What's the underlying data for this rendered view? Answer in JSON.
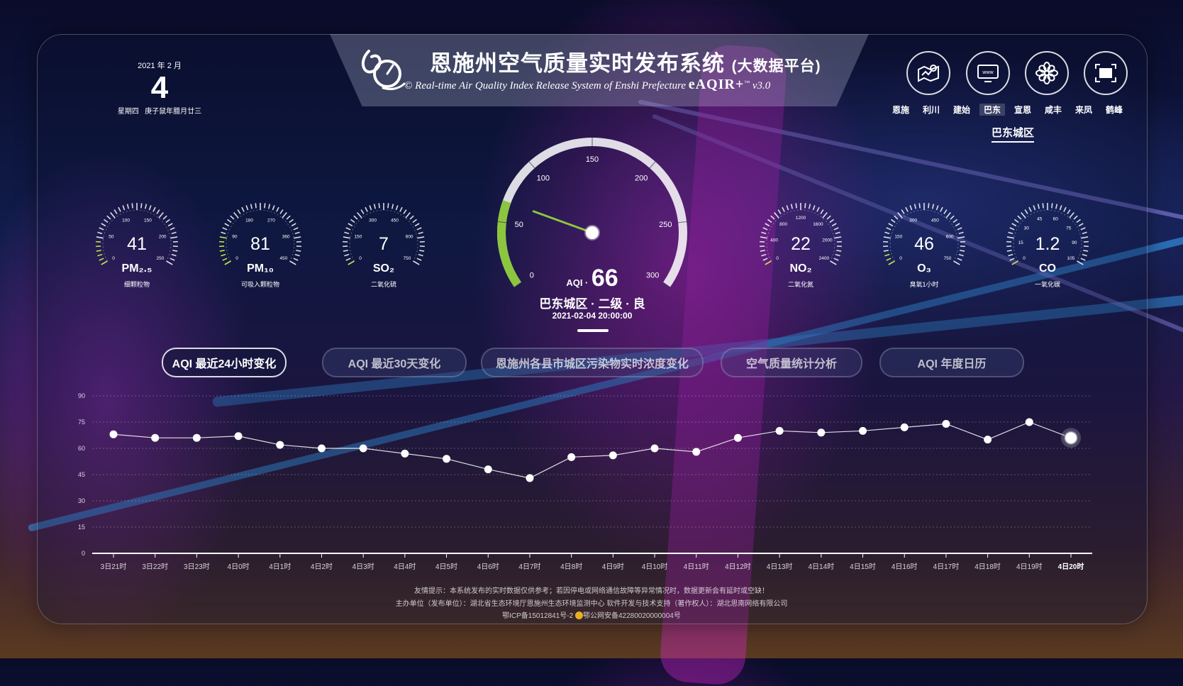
{
  "header": {
    "title": "恩施州空气质量实时发布系统",
    "title_sub": "(大数据平台)",
    "subtitle": "Real-time Air Quality Index Release System of Enshi Prefecture",
    "copyright": "©",
    "brand": "eAQIR+",
    "tm": "™",
    "version": "v3.0"
  },
  "date": {
    "year_month": "2021 年 2 月",
    "day": "4",
    "weekday": "星期四",
    "lunar": "庚子鼠年腊月廿三"
  },
  "icons": [
    {
      "name": "map-icon"
    },
    {
      "name": "web-icon"
    },
    {
      "name": "flower-icon"
    },
    {
      "name": "fullscreen-icon"
    }
  ],
  "cities": [
    "恩施",
    "利川",
    "建始",
    "巴东",
    "宣恩",
    "咸丰",
    "来凤",
    "鹤峰"
  ],
  "active_city": "巴东",
  "district": "巴东城区",
  "pollutants": [
    {
      "value": "41",
      "name": "PM₂.₅",
      "desc": "细颗粒物",
      "ticks": [
        "0",
        "50",
        "100",
        "150",
        "200",
        "250"
      ],
      "max": 250,
      "reading": 41
    },
    {
      "value": "81",
      "name": "PM₁₀",
      "desc": "可吸入颗粒物",
      "ticks": [
        "0",
        "90",
        "180",
        "270",
        "360",
        "450"
      ],
      "max": 450,
      "reading": 81
    },
    {
      "value": "7",
      "name": "SO₂",
      "desc": "二氧化硫",
      "ticks": [
        "0",
        "150",
        "300",
        "450",
        "600",
        "750"
      ],
      "max": 750,
      "reading": 7
    },
    {
      "value": "22",
      "name": "NO₂",
      "desc": "二氧化氮",
      "ticks": [
        "0",
        "400",
        "800",
        "1200",
        "1600",
        "2000",
        "2400"
      ],
      "max": 2400,
      "reading": 22
    },
    {
      "value": "46",
      "name": "O₃",
      "desc": "臭氧1小时",
      "ticks": [
        "0",
        "150",
        "300",
        "450",
        "600",
        "750"
      ],
      "max": 750,
      "reading": 46
    },
    {
      "value": "1.2",
      "name": "CO",
      "desc": "一氧化碳",
      "ticks": [
        "0",
        "15",
        "30",
        "45",
        "60",
        "75",
        "90",
        "105"
      ],
      "max": 105,
      "reading": 1.2
    }
  ],
  "aqi": {
    "label": "AQI ·",
    "value": "66",
    "reading": 66,
    "max": 300,
    "ticks": [
      "0",
      "50",
      "100",
      "150",
      "200",
      "250",
      "300"
    ],
    "status": "巴东城区 · 二级 · 良",
    "time": "2021-02-04 20:00:00",
    "good_color": "#8cc63f"
  },
  "tabs": [
    {
      "label": "AQI 最近24小时变化",
      "active": true
    },
    {
      "label": "AQI 最近30天变化",
      "active": false
    },
    {
      "label": "恩施州各县市城区污染物实时浓度变化",
      "active": false
    },
    {
      "label": "空气质量统计分析",
      "active": false
    },
    {
      "label": "AQI 年度日历",
      "active": false
    }
  ],
  "chart_data": {
    "type": "line",
    "categories": [
      "3日21时",
      "3日22时",
      "3日23时",
      "4日0时",
      "4日1时",
      "4日2时",
      "4日3时",
      "4日4时",
      "4日5时",
      "4日6时",
      "4日7时",
      "4日8时",
      "4日9时",
      "4日10时",
      "4日11时",
      "4日12时",
      "4日13时",
      "4日14时",
      "4日15时",
      "4日16时",
      "4日17时",
      "4日18时",
      "4日19时",
      "4日20时"
    ],
    "values": [
      68,
      66,
      66,
      67,
      62,
      60,
      60,
      57,
      54,
      48,
      43,
      55,
      56,
      60,
      58,
      66,
      70,
      69,
      70,
      72,
      74,
      65,
      75,
      66
    ],
    "yticks": [
      "0",
      "15",
      "30",
      "45",
      "60",
      "75",
      "90"
    ],
    "ylim": [
      0,
      90
    ],
    "grid": true,
    "legend": "none"
  },
  "footer": {
    "notice": "友情提示：本系统发布的实时数据仅供参考；若因停电或网络通信故障等异常情况时，数据更新会有延时或空缺！",
    "sponsor": "主办单位（发布单位）：湖北省生态环境厅恩施州生态环境监测中心      软件开发与技术支持（著作权人）：湖北思南网络有限公司",
    "icp": "鄂ICP备15012841号-2",
    "police": "鄂公网安备42280020000004号"
  }
}
